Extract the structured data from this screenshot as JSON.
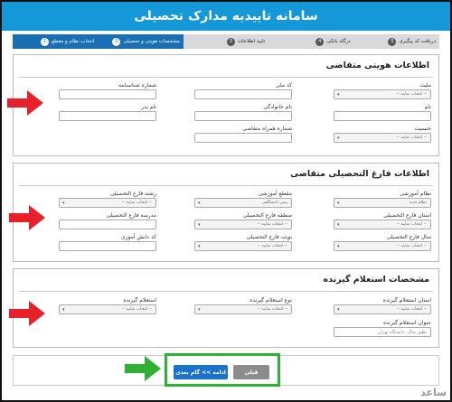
{
  "page_title": "سامانه تاییدیه مدارک تحصیلی",
  "steps": [
    {
      "num": "1",
      "label": "انتخاب نظام و مقطع"
    },
    {
      "num": "2",
      "label": "مشخصات هویتی و تحصیلی"
    },
    {
      "num": "3",
      "label": "تایید اطلاعات"
    },
    {
      "num": "4",
      "label": "درگاه بانکی"
    },
    {
      "num": "5",
      "label": "دریافت کد پیگیری"
    }
  ],
  "identity": {
    "title": "اطلاعات هویتی متقاضی",
    "nationality": "ملیت",
    "national_code": "کد ملی",
    "id_number": "شماره شناسنامه",
    "first_name": "نام",
    "last_name": "نام خانوادگی",
    "father_name": "نام پدر",
    "gender": "جنسیت",
    "mobile": "شماره همراه متقاضی"
  },
  "graduate": {
    "title": "اطلاعات فارغ التحصیلی متقاضی",
    "edu_system": "نظام آموزشی",
    "edu_level": "مقطع آموزشی",
    "major": "رشته فارغ التحصیلی",
    "edu_system_value": "نظام جدید",
    "edu_level_value": "پیش دانشگاهی",
    "province": "استان فارغ التحصیلی",
    "region": "منطقه فارغ التحصیلی",
    "school": "مدرسه فارغ التحصیلی",
    "grad_year": "سال فارغ التحصیلی",
    "turn": "نوبت فارغ التحصیلی",
    "student_code": "کد دانش آموزی"
  },
  "inquiry": {
    "title": "مشخصات استعلام گیرنده",
    "province": "استان استعلام گیرنده",
    "type": "نوع استعلام گیرنده",
    "recipient": "استعلام گیرنده",
    "address_label": "عنوان استعلام گیرنده",
    "address_placeholder": "بطور مثال: دانشگاه تهران"
  },
  "select_placeholder": "-- انتخاب نمایید --",
  "buttons": {
    "next": "ادامه >> گام بعدی",
    "prev": "قبلی"
  },
  "watermark": "ساعد",
  "colors": {
    "header": "#1598d8",
    "step_active": "#1a6fb4",
    "next_button": "#1a73c8",
    "prev_button": "#8c8c8c",
    "red_arrow": "#e8202a",
    "green_arrow": "#2eb135"
  }
}
